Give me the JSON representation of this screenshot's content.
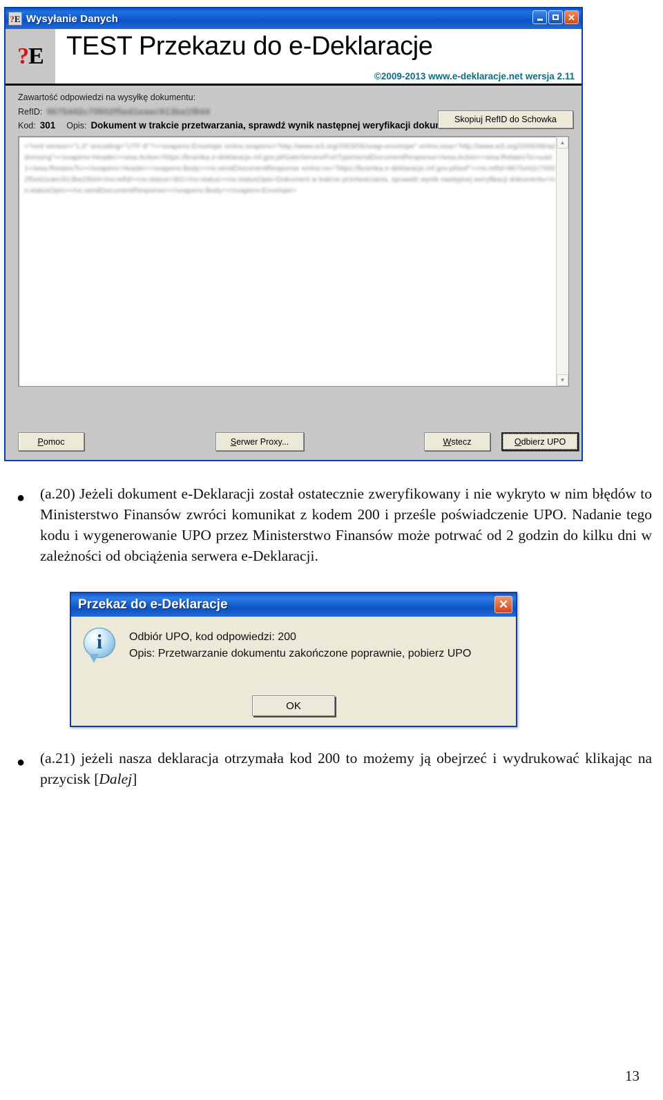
{
  "app_window": {
    "titlebar": {
      "title": "Wysyłanie Danych",
      "icon_question": "?",
      "icon_letter": "E",
      "minimize_label": "",
      "maximize_label": "",
      "close_label": "✕"
    },
    "header": {
      "logo_question": "?",
      "logo_letter": "E",
      "title": "TEST Przekazu do e-Deklaracje",
      "copyright": "©2009-2013 www.e-deklaracje.net wersja 2.11"
    },
    "content": {
      "response_label": "Zawartość odpowiedzi na wysyłkę dokumentu:",
      "refid_key": "RefID:",
      "refid_value": "9675442c70602f5ed1eaec913ba1f844",
      "copy_button": "Skopiuj RefID do Schowka",
      "kod_key": "Kod:",
      "kod_value": "301",
      "opis_key": "Opis:",
      "opis_value": "Dokument w trakcie przetwarzania, sprawdź wynik następnej weryfikacji dokumentu",
      "xml_response": "<?xml version=\"1.0\" encoding=\"UTF-8\"?><soapenv:Envelope xmlns:soapenv=\"http://www.w3.org/2003/05/soap-envelope\" xmlns:wsa=\"http://www.w3.org/2005/08/addressing\"><soapenv:Header><wsa:Action>https://bramka.e-deklaracje.mf.gov.pl/GateServicePortType/sendDocumentResponse</wsa:Action><wsa:RelatesTo>uuid:1</wsa:RelatesTo></soapenv:Header><soapenv:Body><ns:sendDocumentResponse xmlns:ns=\"https://bramka.e-deklaracje.mf.gov.pl/wsf\"><ns:refId>9675442c70602f5ed1eaec913ba1f844</ns:refId><ns:status>301</ns:status><ns:statusOpis>Dokument w trakcie przetwarzania, sprawdź wynik następnej weryfikacji dokumentu</ns:statusOpis></ns:sendDocumentResponse></soapenv:Body></soapenv:Envelope>",
      "scroll_up": "▲",
      "scroll_down": "▼"
    },
    "buttons": {
      "help": "Pomoc",
      "help_mnemonic": "P",
      "help_rest": "omoc",
      "proxy": "Serwer Proxy...",
      "proxy_mnemonic": "S",
      "proxy_rest": "erwer Proxy...",
      "back": "Wstecz",
      "back_mnemonic": "W",
      "back_rest": "stecz",
      "upo": "Odbierz UPO",
      "upo_mnemonic": "O",
      "upo_rest": "dbierz UPO"
    }
  },
  "document": {
    "bullet_glyph": "●",
    "paragraph_a20": "(a.20) Jeżeli dokument e-Deklaracji został ostatecznie zweryfikowany i nie wykryto w nim błędów to Ministerstwo Finansów zwróci komunikat z kodem 200 i prześle poświadczenie UPO. Nadanie tego kodu i wygenerowanie UPO przez Ministerstwo Finansów może potrwać od 2 godzin do kilku dni w zależności od obciążenia serwera e-Deklaracji.",
    "paragraph_a21_pre": "(a.21) jeżeli nasza deklaracja otrzymała kod 200 to możemy ją obejrzeć i wydrukować klikając na przycisk [",
    "paragraph_a21_italic": "Dalej",
    "paragraph_a21_post": "]",
    "page_number": "13"
  },
  "dialog": {
    "title": "Przekaz do e-Deklaracje",
    "close_label": "✕",
    "icon_glyph": "i",
    "message_line1": "Odbiór UPO, kod odpowiedzi: 200",
    "message_line2": "Opis: Przetwarzanie dokumentu zakończone poprawnie, pobierz UPO",
    "ok_button": "OK"
  },
  "colors": {
    "titlebar_blue": "#1057c8",
    "window_gray": "#c8c8c8",
    "dialog_cream": "#ece9d8",
    "copyright_teal": "#0d6c82",
    "logo_red": "#d81414",
    "close_red": "#cf4416"
  }
}
